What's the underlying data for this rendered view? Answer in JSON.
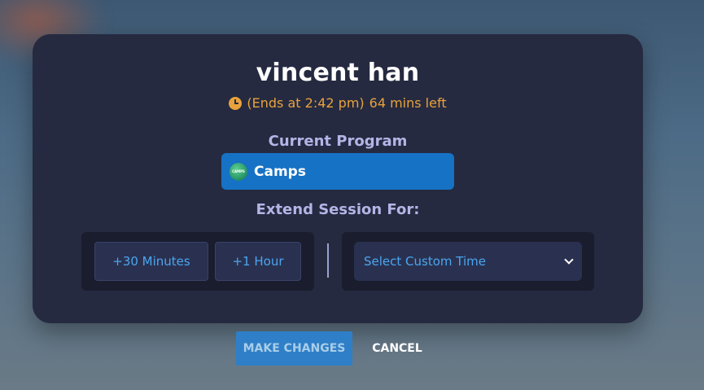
{
  "session": {
    "user_name": "vincent han",
    "ends_text": "(Ends at 2:42 pm)",
    "remaining_text": "64 mins left"
  },
  "program": {
    "label": "Current Program",
    "selected": "Camps",
    "logo_text": "CAMPS"
  },
  "extend": {
    "label": "Extend Session For:",
    "options": [
      "+30 Minutes",
      "+1 Hour"
    ],
    "custom_placeholder": "Select Custom Time"
  },
  "actions": {
    "make_changes": "MAKE CHANGES",
    "cancel": "CANCEL"
  },
  "icons": {
    "clock": "clock-icon",
    "chevron": "chevron-down-icon",
    "program_logo": "camps-logo-icon"
  },
  "colors": {
    "modal_bg": "#252a40",
    "accent_blue": "#1672c4",
    "time_orange": "#e9a23b",
    "label_lavender": "#b4b5e6",
    "option_text": "#4aa6f0"
  }
}
